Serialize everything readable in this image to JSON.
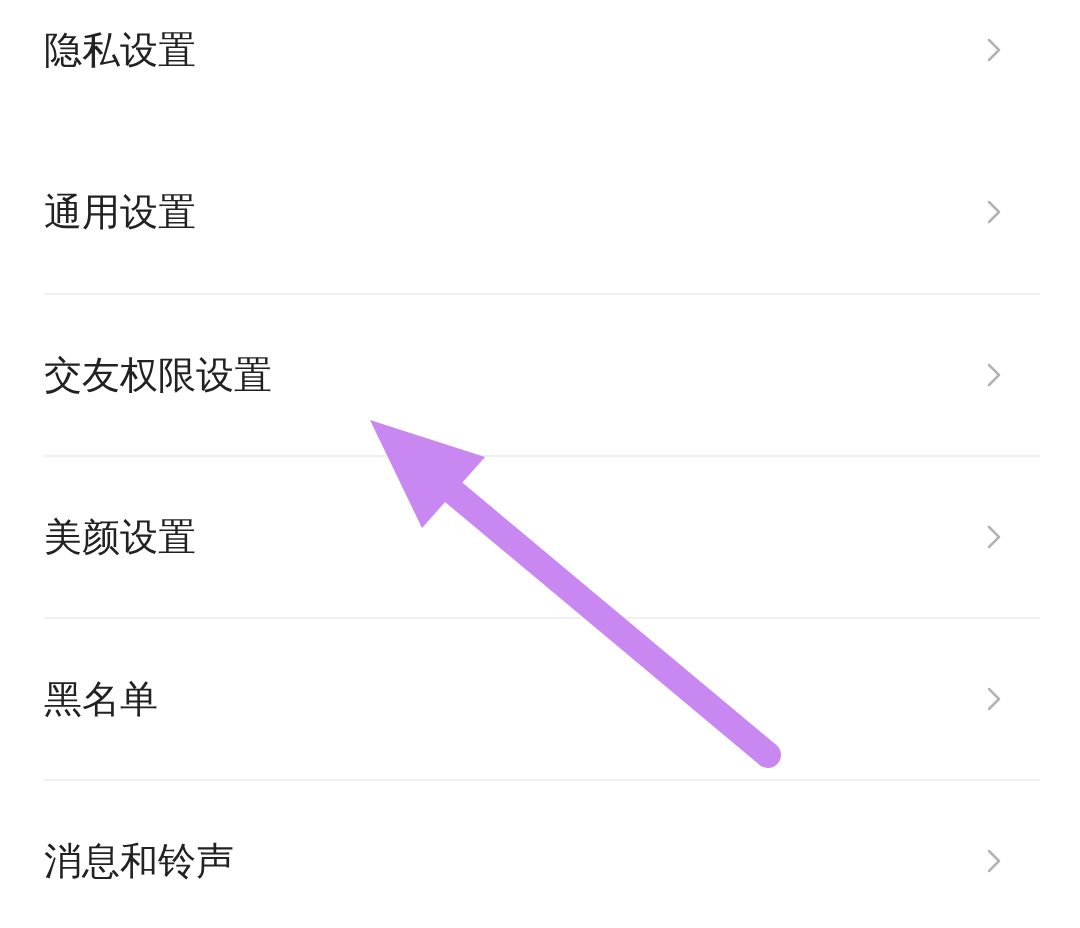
{
  "groups": [
    {
      "items": [
        {
          "label": "隐私设置"
        }
      ]
    },
    {
      "items": [
        {
          "label": "通用设置"
        },
        {
          "label": "交友权限设置"
        },
        {
          "label": "美颜设置"
        },
        {
          "label": "黑名单"
        },
        {
          "label": "消息和铃声"
        }
      ]
    }
  ],
  "annotation": {
    "kind": "arrow"
  }
}
